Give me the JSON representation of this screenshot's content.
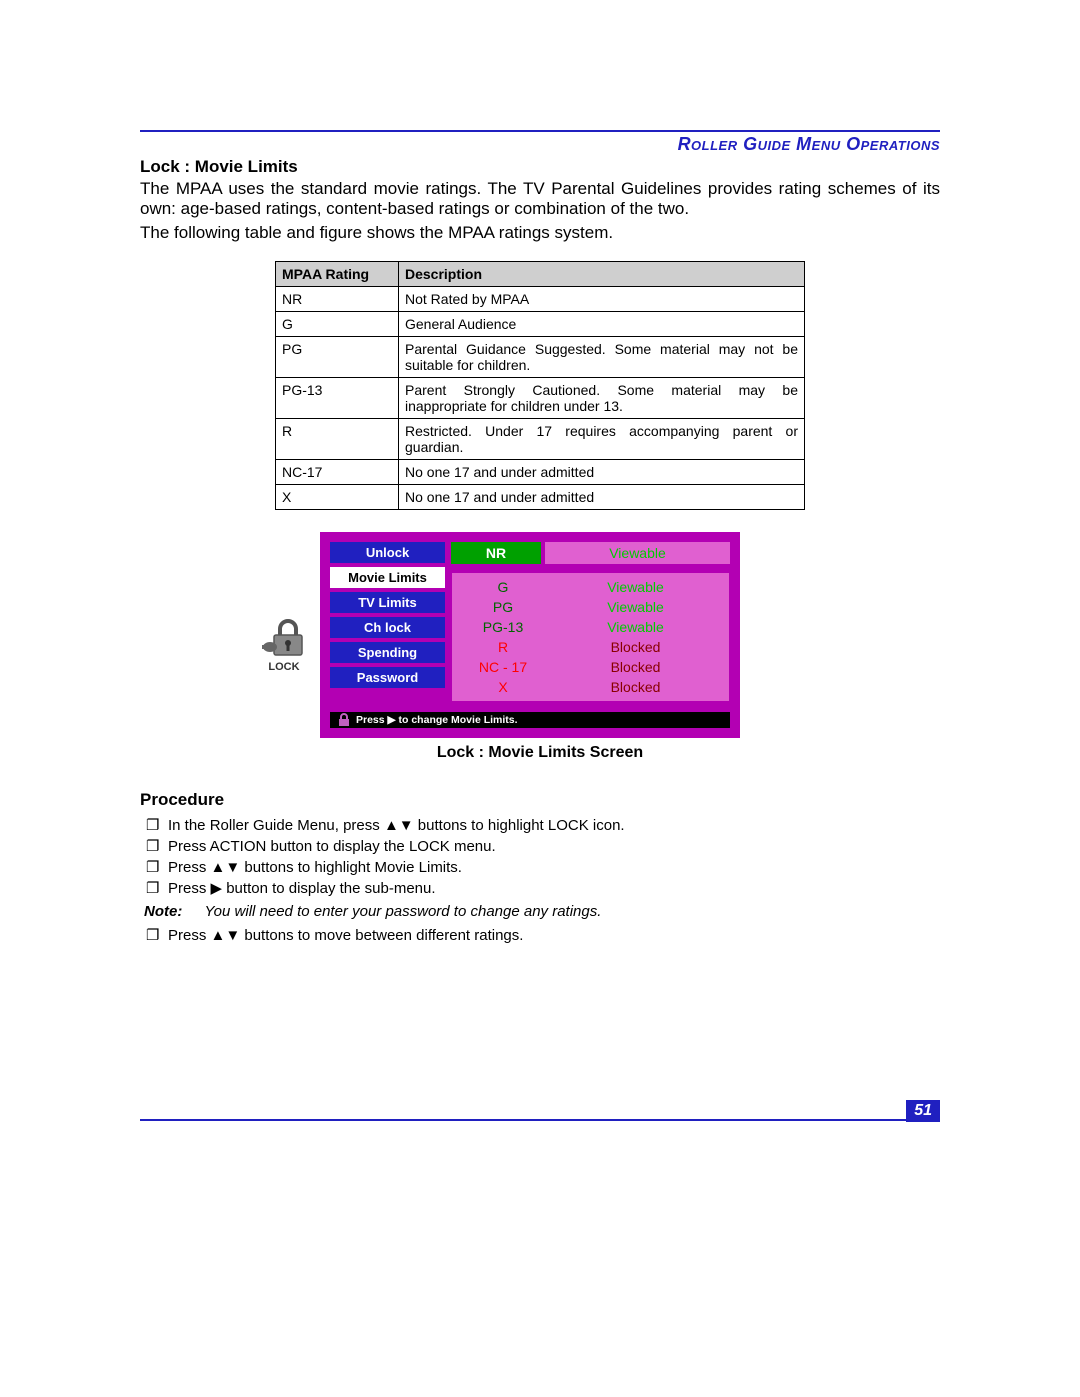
{
  "header": {
    "breadcrumb": "Roller Guide Menu Operations"
  },
  "section_title": "Lock : Movie Limits",
  "intro": "The MPAA uses the standard movie ratings. The TV Parental Guidelines provides rating schemes of its own: age-based ratings, content-based ratings or combination of the two.",
  "intro2": "The following table and figure shows the MPAA ratings system.",
  "table": {
    "headers": [
      "MPAA Rating",
      "Description"
    ],
    "rows": [
      {
        "rating": "NR",
        "desc": "Not Rated by MPAA"
      },
      {
        "rating": "G",
        "desc": "General Audience"
      },
      {
        "rating": "PG",
        "desc": "Parental Guidance Suggested. Some material may not be suitable for children."
      },
      {
        "rating": "PG-13",
        "desc": "Parent Strongly Cautioned. Some material may be inappropriate for children under 13."
      },
      {
        "rating": "R",
        "desc": "Restricted. Under 17 requires accompanying parent or guardian."
      },
      {
        "rating": "NC-17",
        "desc": "No one 17 and under admitted"
      },
      {
        "rating": "X",
        "desc": "No one 17 and under admitted"
      }
    ]
  },
  "lock_icon_label": "LOCK",
  "osd": {
    "menu": [
      {
        "label": "Unlock",
        "style": "blue"
      },
      {
        "label": "Movie Limits",
        "style": "white"
      },
      {
        "label": "TV Limits",
        "style": "blue"
      },
      {
        "label": "Ch lock",
        "style": "blue"
      },
      {
        "label": "Spending",
        "style": "blue"
      },
      {
        "label": "Password",
        "style": "blue"
      }
    ],
    "nr": {
      "label": "NR",
      "status": "Viewable"
    },
    "ratings": [
      {
        "label": "G",
        "status": "Viewable",
        "cls_label": "g-dgreen",
        "cls_status": "g-green"
      },
      {
        "label": "PG",
        "status": "Viewable",
        "cls_label": "g-dgreen",
        "cls_status": "g-green"
      },
      {
        "label": "PG-13",
        "status": "Viewable",
        "cls_label": "g-dgreen",
        "cls_status": "g-green"
      },
      {
        "label": "R",
        "status": "Blocked",
        "cls_label": "r-red",
        "cls_status": "r-dred"
      },
      {
        "label": "NC - 17",
        "status": "Blocked",
        "cls_label": "r-red",
        "cls_status": "r-dred"
      },
      {
        "label": "X",
        "status": "Blocked",
        "cls_label": "r-red",
        "cls_status": "r-dred"
      }
    ],
    "footer": "Press ▶ to change Movie Limits."
  },
  "osd_caption": "Lock : Movie Limits Screen",
  "procedure_title": "Procedure",
  "procedure": [
    "In the Roller Guide Menu, press ▲▼    buttons to highlight LOCK icon.",
    "Press ACTION button to display the LOCK menu.",
    "Press ▲▼ buttons to highlight Movie Limits.",
    "Press ▶ button to display the sub-menu."
  ],
  "note_label": "Note:",
  "note_text": "You will need to enter your password to change any ratings.",
  "procedure2": [
    "Press ▲▼ buttons to move between different ratings."
  ],
  "page_number": "51"
}
